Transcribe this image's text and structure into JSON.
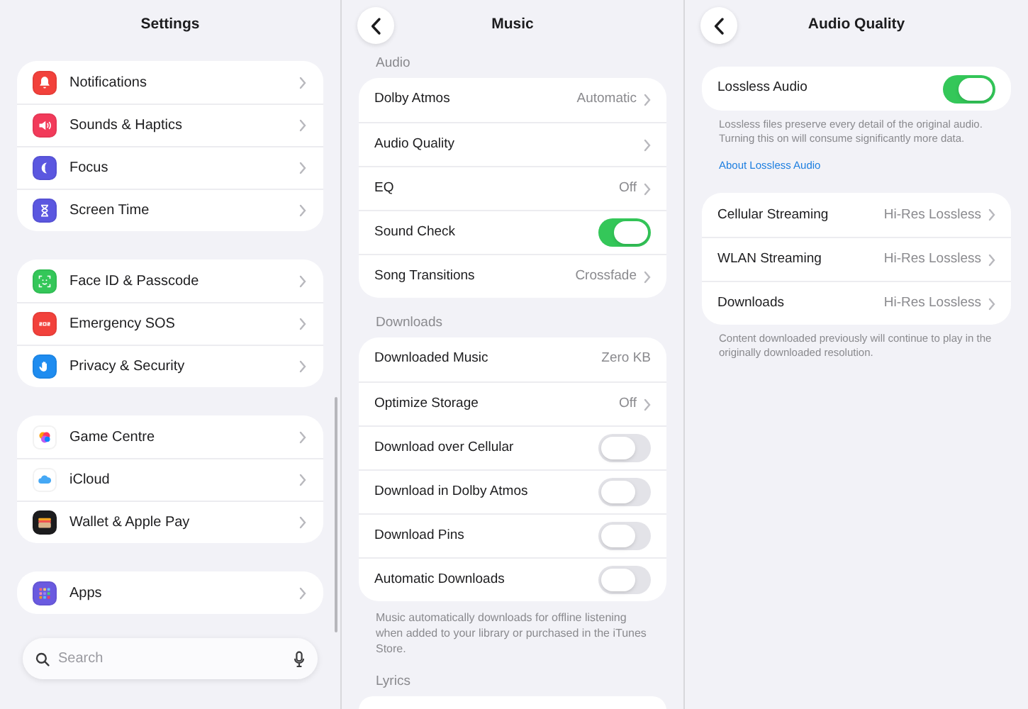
{
  "settings": {
    "title": "Settings",
    "groups": [
      [
        {
          "label": "Notifications",
          "color": "#f2413b"
        },
        {
          "label": "Sounds & Haptics",
          "color": "#f23a5a"
        },
        {
          "label": "Focus",
          "color": "#5b57e0"
        },
        {
          "label": "Screen Time",
          "color": "#5b57e0"
        }
      ],
      [
        {
          "label": "Face ID & Passcode",
          "color": "#34c759"
        },
        {
          "label": "Emergency SOS",
          "color": "#f2413b"
        },
        {
          "label": "Privacy & Security",
          "color": "#1e8cf0"
        }
      ],
      [
        {
          "label": "Game Centre",
          "color": "#ffffff"
        },
        {
          "label": "iCloud",
          "color": "#ffffff"
        },
        {
          "label": "Wallet & Apple Pay",
          "color": "#1c1c1e"
        }
      ],
      [
        {
          "label": "Apps",
          "color": "#6a5ae0"
        }
      ]
    ],
    "search": {
      "placeholder": "Search"
    }
  },
  "music": {
    "title": "Music",
    "sections": [
      {
        "header": "Audio",
        "rows": [
          {
            "kind": "nav",
            "label": "Dolby Atmos",
            "value": "Automatic"
          },
          {
            "kind": "nav",
            "label": "Audio Quality"
          },
          {
            "kind": "nav",
            "label": "EQ",
            "value": "Off"
          },
          {
            "kind": "toggle",
            "label": "Sound Check",
            "on": true
          },
          {
            "kind": "nav",
            "label": "Song Transitions",
            "value": "Crossfade"
          }
        ]
      },
      {
        "header": "Downloads",
        "rows": [
          {
            "kind": "info",
            "label": "Downloaded Music",
            "value": "Zero KB"
          },
          {
            "kind": "nav",
            "label": "Optimize Storage",
            "value": "Off"
          },
          {
            "kind": "toggle",
            "label": "Download over Cellular",
            "on": false
          },
          {
            "kind": "toggle",
            "label": "Download in Dolby Atmos",
            "on": false
          },
          {
            "kind": "toggle",
            "label": "Download Pins",
            "on": false
          },
          {
            "kind": "toggle",
            "label": "Automatic Downloads",
            "on": false
          }
        ],
        "footer": "Music automatically downloads for offline listening when added to your library or purchased in the iTunes Store."
      },
      {
        "header": "Lyrics"
      }
    ]
  },
  "audio_quality": {
    "title": "Audio Quality",
    "lossless": {
      "label": "Lossless Audio",
      "on": true
    },
    "lossless_footer": "Lossless files preserve every detail of the original audio. Turning this on will consume significantly more data.",
    "link": "About Lossless Audio",
    "rows": [
      {
        "label": "Cellular Streaming",
        "value": "Hi-Res Lossless"
      },
      {
        "label": "WLAN Streaming",
        "value": "Hi-Res Lossless"
      },
      {
        "label": "Downloads",
        "value": "Hi-Res Lossless"
      }
    ],
    "footer": "Content downloaded previously will continue to play in the originally downloaded resolution."
  }
}
